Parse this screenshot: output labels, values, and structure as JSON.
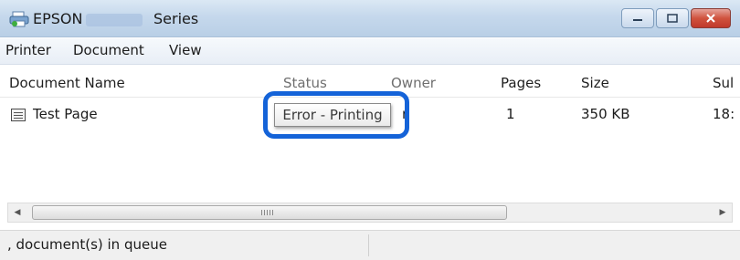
{
  "window": {
    "title_brand": "EPSON",
    "title_series": "Series"
  },
  "menu": {
    "items": [
      "Printer",
      "Document",
      "View"
    ]
  },
  "table": {
    "headers": [
      "Document Name",
      "Status",
      "Owner",
      "Pages",
      "Size",
      "Sul"
    ],
    "rows": [
      {
        "document_name": "Test Page",
        "status": "Error - Printing",
        "owner": "r",
        "pages": "1",
        "size": "350 KB",
        "submitted": "18:"
      }
    ]
  },
  "scrollbar": {
    "grip_label": "III"
  },
  "statusbar": {
    "text": ", document(s) in queue"
  },
  "colors": {
    "highlight": "#1463d8",
    "close_button": "#c0392b",
    "titlebar": "#c5d8ec"
  },
  "icons": [
    "printer-icon",
    "minimize-icon",
    "maximize-icon",
    "close-icon",
    "document-icon",
    "scroll-left-icon",
    "scroll-right-icon"
  ]
}
